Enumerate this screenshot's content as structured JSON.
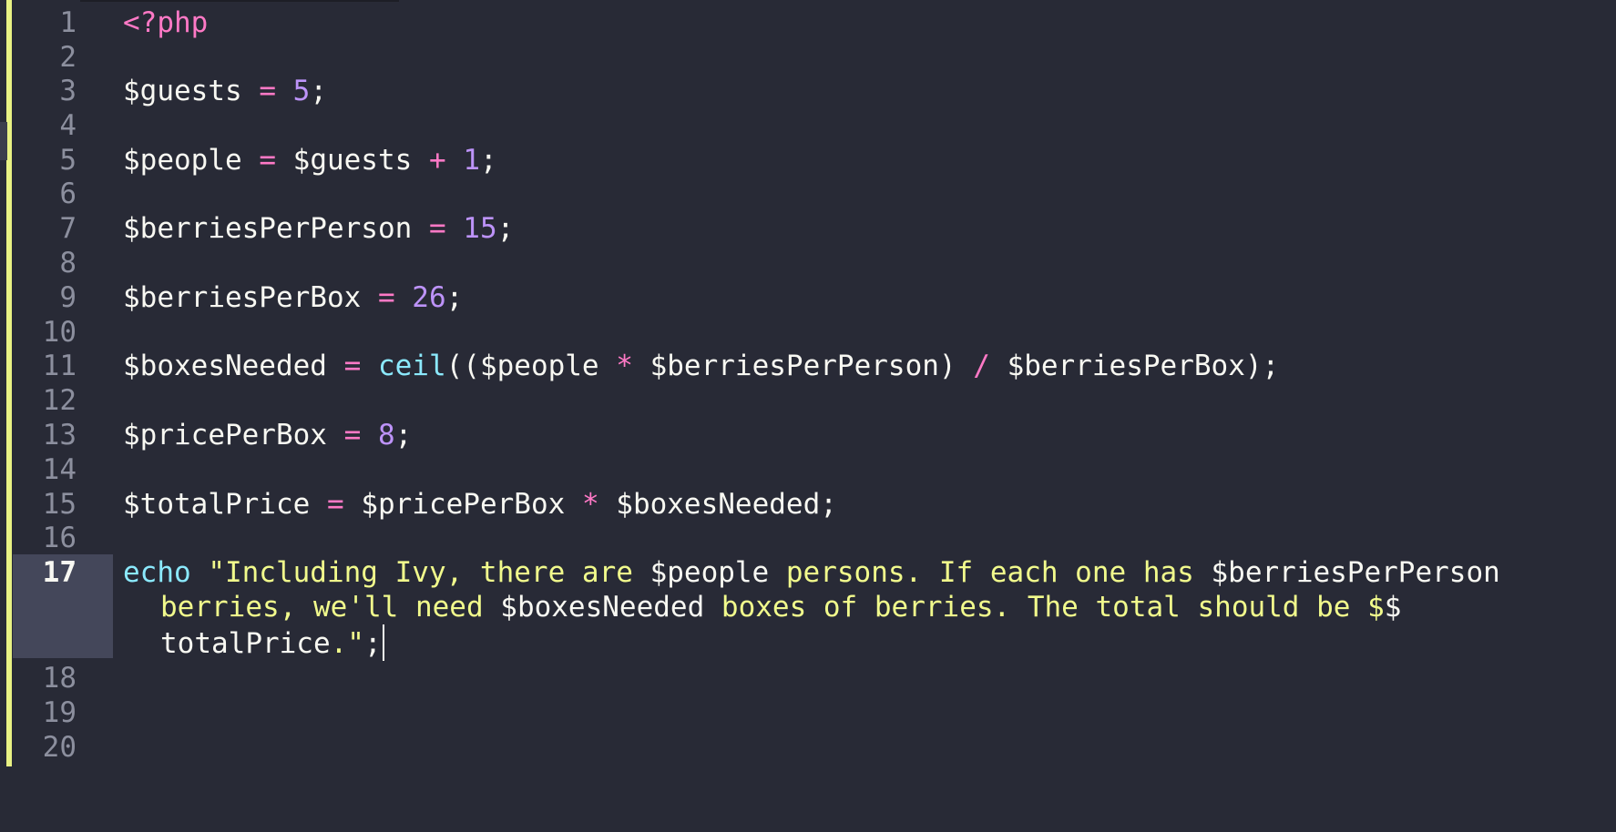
{
  "editor": {
    "line_numbers": [
      "1",
      "2",
      "3",
      "4",
      "5",
      "6",
      "7",
      "8",
      "9",
      "10",
      "11",
      "12",
      "13",
      "14",
      "15",
      "16",
      "17",
      "18",
      "19",
      "20"
    ],
    "active_line": "17",
    "colors": {
      "background": "#282a36",
      "gutter_active": "#44475a",
      "line_number": "#8c8f9e",
      "modified_bar": "#e9f284",
      "keyword_pink": "#ff79c6",
      "number_purple": "#bd93f9",
      "function_cyan": "#8be9fd",
      "string_yellow": "#f1fa8c",
      "text": "#f8f8f2"
    },
    "code": {
      "l1": {
        "open_tag": "<?php"
      },
      "l3": {
        "var": "$guests",
        "op": " = ",
        "num": "5",
        "end": ";"
      },
      "l5": {
        "var": "$people",
        "op1": " = ",
        "var2": "$guests",
        "op2": " + ",
        "num": "1",
        "end": ";"
      },
      "l7": {
        "var": "$berriesPerPerson",
        "op": " = ",
        "num": "15",
        "end": ";"
      },
      "l9": {
        "var": "$berriesPerBox",
        "op": " = ",
        "num": "26",
        "end": ";"
      },
      "l11": {
        "var": "$boxesNeeded",
        "op": " = ",
        "fn": "ceil",
        "p1": "((",
        "v1": "$people",
        "op2": " * ",
        "v2": "$berriesPerPerson",
        "p2": ")",
        "op3": " / ",
        "v3": "$berriesPerBox",
        "end": ");"
      },
      "l13": {
        "var": "$pricePerBox",
        "op": " = ",
        "num": "8",
        "end": ";"
      },
      "l15": {
        "var": "$totalPrice",
        "op1": " = ",
        "v1": "$pricePerBox",
        "op2": " * ",
        "v2": "$boxesNeeded",
        "end": ";"
      },
      "l17": {
        "kw": "echo",
        "s1": " \"Including Ivy, there are ",
        "v1": "$people",
        "s2": " persons. If each one has ",
        "v2": "$berriesPerPerson",
        "s3": "berries, we'll need ",
        "v3": "$boxesNeeded",
        "s4": " boxes of berries. The total should be $",
        "v4a": "$",
        "v4b": "totalPrice",
        "s5": ".\"",
        "end": ";"
      }
    }
  }
}
